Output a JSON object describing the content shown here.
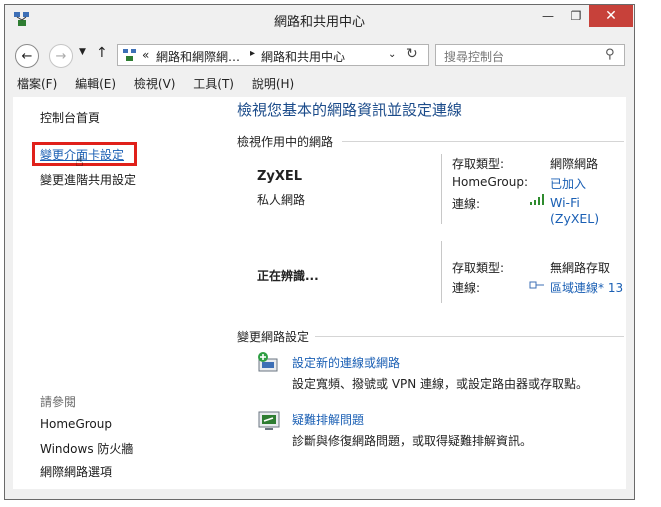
{
  "window": {
    "title": "網路和共用中心",
    "minimize_glyph": "—",
    "restore_glyph": "❐",
    "close_glyph": "✕"
  },
  "address": {
    "crumb_1": "網路和網際網…",
    "crumb_sep": "▸",
    "crumb_2": "網路和共用中心",
    "chevron_left": "«",
    "search_placeholder": "搜尋控制台"
  },
  "menu": [
    "檔案(F)",
    "編輯(E)",
    "檢視(V)",
    "工具(T)",
    "說明(H)"
  ],
  "sidebar": {
    "home": "控制台首頁",
    "items": [
      "變更介面卡設定",
      "變更進階共用設定"
    ],
    "see_also": "請參閱",
    "see_also_items": [
      "HomeGroup",
      "Windows 防火牆",
      "網際網路選項"
    ]
  },
  "main": {
    "heading": "檢視您基本的網路資訊並設定連線",
    "active_networks_label": "檢視作用中的網路",
    "networks": [
      {
        "name": "ZyXEL",
        "type": "私人網路",
        "access_label": "存取類型:",
        "access_value": "網際網路",
        "homegroup_label": "HomeGroup:",
        "homegroup_value": "已加入",
        "conn_label": "連線:",
        "conn_value_1": "Wi-Fi",
        "conn_value_2": "(ZyXEL)"
      },
      {
        "name": "正在辨識...",
        "access_label": "存取類型:",
        "access_value": "無網路存取",
        "conn_label": "連線:",
        "conn_value": "區域連線* 13"
      }
    ],
    "change_label": "變更網路設定",
    "tasks": [
      {
        "title": "設定新的連線或網路",
        "desc": "設定寬頻、撥號或 VPN 連線，或設定路由器或存取點。"
      },
      {
        "title": "疑難排解問題",
        "desc": "診斷與修復網路問題，或取得疑難排解資訊。"
      }
    ]
  }
}
